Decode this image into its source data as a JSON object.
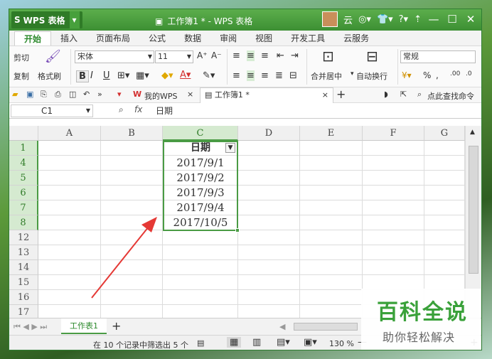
{
  "app": {
    "name": "WPS 表格",
    "doc_title": "工作簿1 * - WPS 表格",
    "user_label": "云"
  },
  "menu": {
    "tabs": [
      "开始",
      "插入",
      "页面布局",
      "公式",
      "数据",
      "审阅",
      "视图",
      "开发工具",
      "云服务"
    ],
    "active": "开始"
  },
  "ribbon": {
    "cut": "剪切",
    "copy": "复制",
    "format_painter": "格式刷",
    "font_name": "宋体",
    "font_size": "11",
    "merge_center": "合并居中",
    "wrap_text": "自动换行",
    "number_format": "常规",
    "percent": "%"
  },
  "quickbar": {
    "my_wps": "我的WPS",
    "doc_tab": "工作簿1 *",
    "search": "点此查找命令"
  },
  "formula_bar": {
    "cell_ref": "C1",
    "fx": "fx",
    "value": "日期"
  },
  "columns": [
    "A",
    "B",
    "C",
    "D",
    "E",
    "F",
    "G"
  ],
  "rows": [
    "1",
    "4",
    "5",
    "6",
    "7",
    "8",
    "12",
    "13",
    "14",
    "15",
    "16",
    "17"
  ],
  "table": {
    "header": "日期",
    "values": [
      "2017/9/1",
      "2017/9/2",
      "2017/9/3",
      "2017/9/4",
      "2017/10/5"
    ]
  },
  "sheet": {
    "tab": "工作表1",
    "add": "+"
  },
  "status": {
    "filter_info": "在 10 个记录中筛选出 5 个",
    "zoom": "130 %"
  },
  "watermark": {
    "line1": "百科全说",
    "line2": "助你轻松解决"
  },
  "colors": {
    "accent": "#4a9b44",
    "title_bar": "#3c8f33",
    "arrow": "#e53935"
  }
}
